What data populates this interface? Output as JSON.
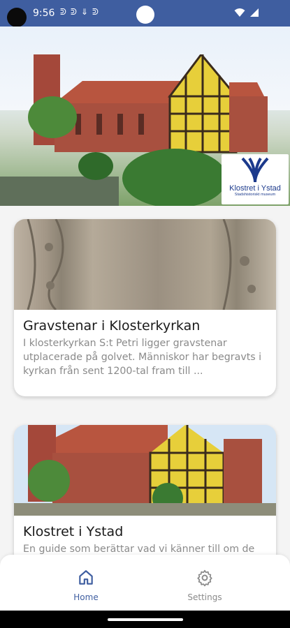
{
  "status_bar": {
    "time": "9:56",
    "notification_icons": [
      "notification-icon",
      "notification-icon",
      "notification-icon",
      "notification-icon"
    ],
    "bg_color": "#3f5ea0"
  },
  "hero": {
    "logo_title": "Klostret i Ystad",
    "logo_subtitle": "Stadshistoriskt museum"
  },
  "cards": [
    {
      "title": "Gravstenar i Klosterkyrkan",
      "description": "I klosterkyrkan S:t Petri ligger gravstenar utplacerade på golvet. Människor har begravts i kyrkan från sent 1200-tal fram till ...",
      "image": "gravestone-photo"
    },
    {
      "title": "Klostret i Ystad",
      "description": "En guide som berättar vad vi känner till om de",
      "image": "monastery-photo"
    }
  ],
  "bottom_nav": {
    "items": [
      {
        "label": "Home",
        "icon": "home-icon",
        "active": true
      },
      {
        "label": "Settings",
        "icon": "gear-icon",
        "active": false
      }
    ],
    "active_color": "#3f5ea0",
    "inactive_color": "#8a8a8a"
  }
}
